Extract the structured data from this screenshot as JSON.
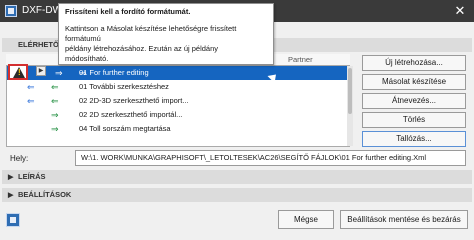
{
  "window": {
    "title": "DXF-DWG a",
    "close_glyph": "✕"
  },
  "sections": {
    "available": "ELÉRHETŐ FO",
    "description": "LEÍRÁS",
    "settings": "BEÁLLÍTÁSOK"
  },
  "table": {
    "headers": {
      "name_partial": "ÉV",
      "partner": "Partner"
    },
    "rows": [
      {
        "arrow1": "⇒",
        "arrow2": "⇒",
        "name": "01 For further editing",
        "selected": true
      },
      {
        "arrow1": "⇐",
        "arrow2": "⇐",
        "name": "01 További szerkesztéshez",
        "selected": false
      },
      {
        "arrow1": "⇐",
        "arrow2": "⇐",
        "name": "02 2D-3D szerkeszthető import...",
        "selected": false
      },
      {
        "arrow1": "",
        "arrow2": "⇒",
        "name": "02 2D szerkeszthető importál...",
        "selected": false
      },
      {
        "arrow1": "",
        "arrow2": "⇒",
        "name": "04 Toll sorszám megtartása",
        "selected": false
      }
    ]
  },
  "warning": {
    "icon": "warning-icon",
    "mark": "!"
  },
  "side_buttons": {
    "new": "Új létrehozása...",
    "copy": "Másolat készítése",
    "rename": "Átnevezés...",
    "delete": "Törlés",
    "browse": "Tallózás..."
  },
  "path": {
    "label": "Hely:",
    "value": "W:\\1. WORK\\MUNKA\\GRAPHISOFT\\_LETOLTESEK\\AC26\\SEGÍTŐ FÁJLOK\\01 For further editing.Xml"
  },
  "footer": {
    "cancel": "Mégse",
    "save_close": "Beállítások mentése és bezárás"
  },
  "tooltip": {
    "title": "Frissíteni kell a fordító formátumát.",
    "line1": "Kattintson a Másolat készítése lehetőségre frissített formátumú",
    "line2": "példány létrehozásához. Ezután az új példány",
    "line3": "módosítható."
  },
  "colors": {
    "selection": "#1565c0",
    "warning_border": "#d32f2f",
    "titlebar": "#3a3a3a"
  }
}
